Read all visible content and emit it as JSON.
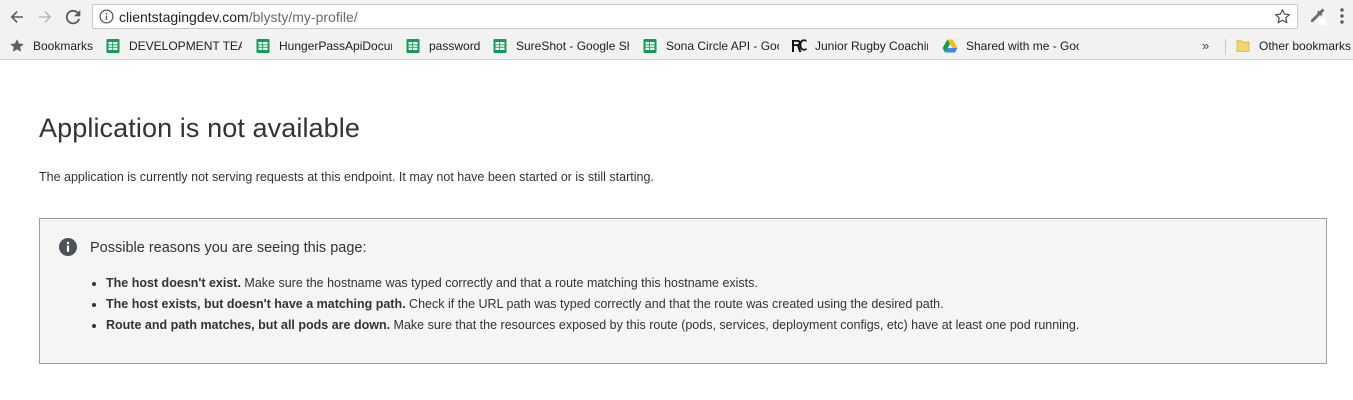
{
  "browser": {
    "url_host": "clientstagingdev.com",
    "url_path": "/blysty/my-profile/"
  },
  "bookmarks": {
    "items": [
      {
        "label": "Bookmarks",
        "icon": "star-icon"
      },
      {
        "label": "DEVELOPMENT TEAM",
        "icon": "sheets-icon"
      },
      {
        "label": "HungerPassApiDocum",
        "icon": "sheets-icon"
      },
      {
        "label": "password",
        "icon": "sheets-icon"
      },
      {
        "label": "SureShot - Google Sh",
        "icon": "sheets-icon"
      },
      {
        "label": "Sona Circle API - Goo",
        "icon": "sheets-icon"
      },
      {
        "label": "Junior Rugby Coachin",
        "icon": "rc-logo-icon"
      },
      {
        "label": "Shared with me - Goo",
        "icon": "drive-icon"
      }
    ],
    "overflow": "»",
    "other": "Other bookmarks"
  },
  "page": {
    "title": "Application is not available",
    "description": "The application is currently not serving requests at this endpoint. It may not have been started or is still starting.",
    "reasons_title": "Possible reasons you are seeing this page:",
    "reasons": [
      {
        "bold": "The host doesn't exist.",
        "text": " Make sure the hostname was typed correctly and that a route matching this hostname exists."
      },
      {
        "bold": "The host exists, but doesn't have a matching path.",
        "text": " Check if the URL path was typed correctly and that the route was created using the desired path."
      },
      {
        "bold": "Route and path matches, but all pods are down.",
        "text": " Make sure that the resources exposed by this route (pods, services, deployment configs, etc) have at least one pod running."
      }
    ]
  },
  "colors": {
    "sheets_green": "#0f9d58",
    "folder_yellow": "#f6d46c",
    "chrome_bg": "#f2f2f2",
    "box_bg": "#f5f5f5"
  }
}
